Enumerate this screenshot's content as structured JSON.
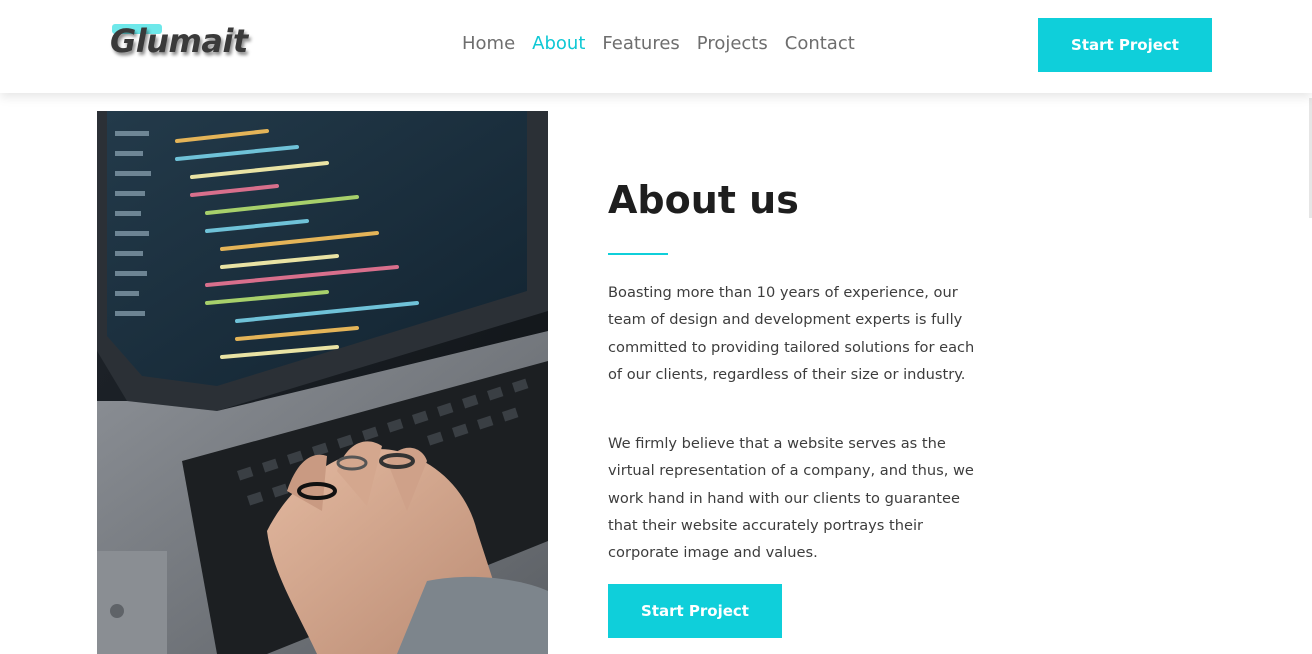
{
  "header": {
    "logo_text": "Glumait",
    "nav": [
      {
        "label": "Home",
        "active": false
      },
      {
        "label": "About",
        "active": true
      },
      {
        "label": "Features",
        "active": false
      },
      {
        "label": "Projects",
        "active": false
      },
      {
        "label": "Contact",
        "active": false
      }
    ],
    "cta_label": "Start Project"
  },
  "about": {
    "title": "About us",
    "paragraphs": [
      "Boasting more than 10 years of experience, our team of design and development experts is fully committed to providing tailored solutions for each of our clients, regardless of their size or industry.",
      "We firmly believe that a website serves as the virtual representation of a company, and thus, we work hand in hand with our clients to guarantee that their website accurately portrays their corporate image and values."
    ],
    "cta_label": "Start Project"
  },
  "colors": {
    "accent": "#0fcfda",
    "active_nav": "#0fc8d4",
    "text": "#3d3d3d",
    "heading": "#1e1e1e"
  },
  "icons": {
    "hero_image": "laptop-code-photo"
  }
}
